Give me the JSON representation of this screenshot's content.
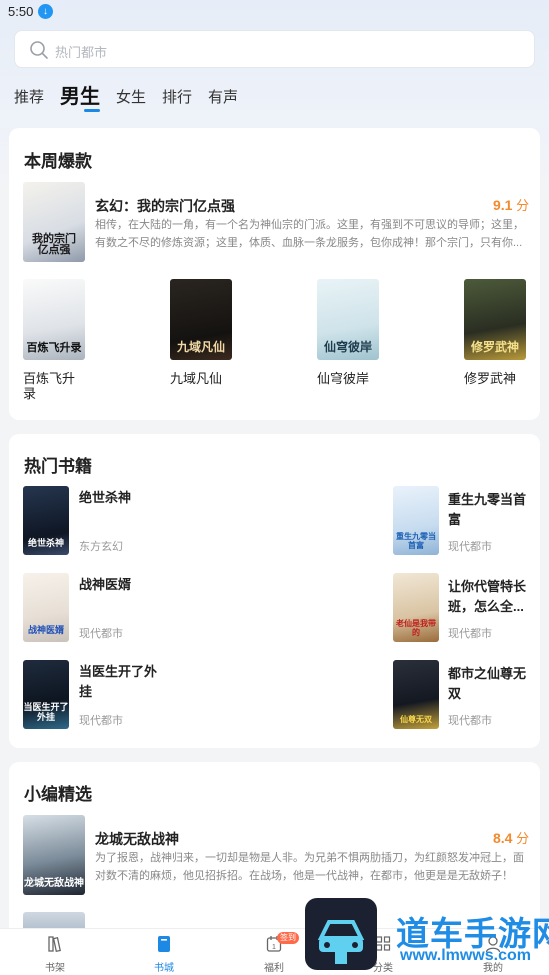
{
  "status": {
    "time": "5:50"
  },
  "search": {
    "placeholder": "热门都市"
  },
  "tabs": [
    {
      "label": "推荐"
    },
    {
      "label": "男生",
      "active": true
    },
    {
      "label": "女生"
    },
    {
      "label": "排行"
    },
    {
      "label": "有声"
    }
  ],
  "weekly": {
    "title": "本周爆款",
    "featured": {
      "title": "玄幻：我的宗门亿点强",
      "score_num": "9.1",
      "score_unit": "分",
      "desc": "相传，在大陆的一角，有一个名为神仙宗的门派。这里，有强到不可思议的导师；这里，有数之不尽的修炼资源；这里，体质、血脉一条龙服务，包你成神！那个宗门，只有你...",
      "cover_text": "我的宗门亿点强"
    },
    "grid": [
      {
        "title": "百炼飞升录",
        "cover_text": "百炼飞升录"
      },
      {
        "title": "九域凡仙",
        "cover_text": "九域凡仙"
      },
      {
        "title": "仙穹彼岸",
        "cover_text": "仙穹彼岸"
      },
      {
        "title": "修罗武神",
        "cover_text": "修罗武神"
      }
    ]
  },
  "hot": {
    "title": "热门书籍",
    "items": [
      {
        "title": "绝世杀神",
        "category": "东方玄幻",
        "cover_text": "绝世杀神"
      },
      {
        "title": "重生九零当首富",
        "category": "现代都市",
        "cover_text": "重生九零当首富"
      },
      {
        "title": "战神医婿",
        "category": "现代都市",
        "cover_text": "战神医婿"
      },
      {
        "title": "让你代管特长班，怎么全...",
        "category": "现代都市",
        "cover_text": "老仙是我带的"
      },
      {
        "title": "当医生开了外挂",
        "category": "现代都市",
        "cover_text": "当医生开了外挂"
      },
      {
        "title": "都市之仙尊无双",
        "category": "现代都市",
        "cover_text": "仙尊无双"
      }
    ]
  },
  "picks": {
    "title": "小编精选",
    "featured": {
      "title": "龙城无敌战神",
      "score_num": "8.4",
      "score_unit": "分",
      "desc": "为了报恩，战神归来，一切却是物是人非。为兄弟不惧两肋插刀，为红颜怒发冲冠上，面对数不清的麻烦，他见招拆招。在战场，他是一代战神，在都市，他更是是无敌娇子！",
      "cover_text": "龙城无敌战神"
    }
  },
  "bottom_nav": [
    {
      "label": "书架",
      "icon": "bookshelf-icon"
    },
    {
      "label": "书城",
      "icon": "bookstore-icon",
      "active": true
    },
    {
      "label": "福利",
      "icon": "gift-calendar-icon",
      "badge": "签到"
    },
    {
      "label": "分类",
      "icon": "grid-icon"
    },
    {
      "label": "我的",
      "icon": "user-icon"
    }
  ],
  "watermark": {
    "text1": "道车手游网",
    "text2": "www.lmwws.com"
  },
  "colors": {
    "accent": "#1e88e5",
    "score": "#f28a2e"
  }
}
